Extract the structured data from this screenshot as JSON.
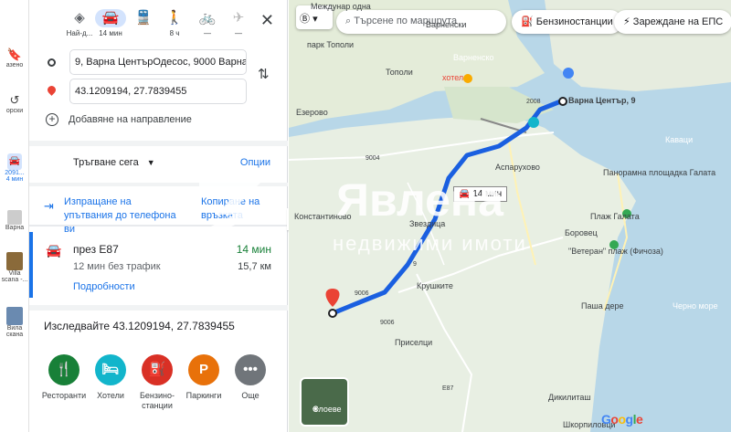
{
  "rail": {
    "saved_label": "азено",
    "recent_label": "орски",
    "trip1_label": "2091...",
    "trip1_sub": "4 мин",
    "trip2_label": "Варна",
    "trip3_label": "Villa",
    "trip3_sub": "scana -...",
    "trip4_label": "Вила",
    "trip4_sub": "скана"
  },
  "modes": [
    {
      "label": "Най-д...",
      "icon": "diamond-route-icon"
    },
    {
      "label": "14 мин",
      "icon": "car-icon",
      "active": true
    },
    {
      "label": "",
      "icon": "train-icon"
    },
    {
      "label": "8 ч",
      "icon": "walk-icon"
    },
    {
      "label": "—",
      "icon": "bike-icon"
    },
    {
      "label": "—",
      "icon": "plane-icon"
    }
  ],
  "origin_value": "9, Варна ЦентърОдесос, 9000 Варна",
  "destination_value": "43.1209194, 27.7839455",
  "add_destination": "Добавяне на направление",
  "depart_label": "Тръгване сега",
  "options_label": "Опции",
  "send_label": "Изпращане на упътвания до телефона ви",
  "copy_label": "Копиране на връзката",
  "route": {
    "name": "през E87",
    "time": "14 мин",
    "sub": "12 мин без трафик",
    "distance": "15,7 км",
    "details": "Подробности"
  },
  "explore_title": "Изследвайте 43.1209194, 27.7839455",
  "categories": [
    {
      "label": "Ресторанти",
      "icon": "fork-knife-icon",
      "color": "#188038",
      "glyph": "🍴"
    },
    {
      "label": "Хотели",
      "icon": "bed-icon",
      "color": "#12b5cb",
      "glyph": "▭"
    },
    {
      "label": "Бензино-станции",
      "icon": "gas-pump-icon",
      "color": "#d93025",
      "glyph": "⛽"
    },
    {
      "label": "Паркинги",
      "icon": "parking-icon",
      "color": "#e8710a",
      "glyph": "P"
    },
    {
      "label": "Още",
      "icon": "more-icon",
      "color": "#70757a",
      "glyph": "…"
    }
  ],
  "map": {
    "search_placeholder": "Търсене по маршрута",
    "chips": [
      "Бензиностанции",
      "Зареждане на ЕПС"
    ],
    "labels": [
      "Междунар одна",
      "Тополи",
      "Езерово",
      "парк Тополи",
      "хотел",
      "Варна Център, 9",
      "Аспарухово",
      "Звездица",
      "Крушките",
      "Приселци",
      "Константиново",
      "Плаж Галата",
      "Боровец",
      "Панорамна площадка Галата",
      "\"Ветеран\" плаж (Фичоза)",
      "Паша дере",
      "Дикилиташ",
      "Варненско",
      "Варненски",
      "Каваци",
      "Черно море",
      "Шкорпиловци"
    ],
    "road_labels": [
      "9004",
      "9006",
      "9",
      "2008",
      "E87",
      "9006"
    ],
    "travel_time": "14 мин",
    "layers_label": "Слоеве",
    "google": "Google",
    "watermark_line1": "Явлена",
    "watermark_line2": "недвижими имоти"
  },
  "colors": {
    "accent": "#1a73e8",
    "route": "#1a5fe0",
    "land": "#e8efe3",
    "water": "#b8d7e8"
  }
}
